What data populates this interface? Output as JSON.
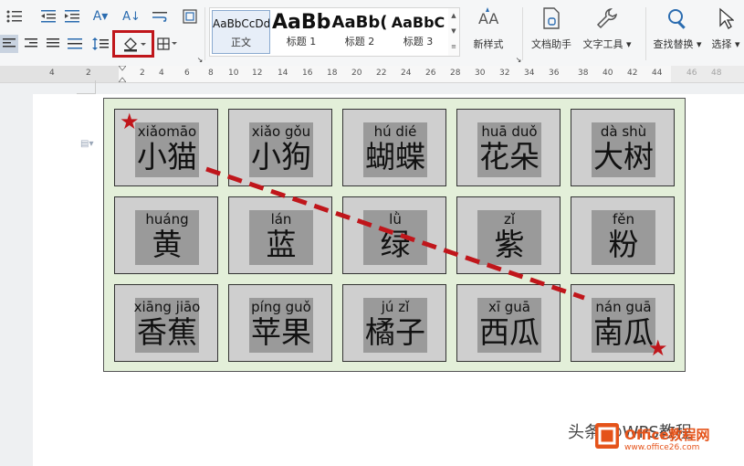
{
  "ribbon": {
    "styles": [
      {
        "preview": "AaBbCcDd",
        "label": "正文"
      },
      {
        "preview": "AaBb",
        "label": "标题 1"
      },
      {
        "preview": "AaBb(",
        "label": "标题 2"
      },
      {
        "preview": "AaBbC",
        "label": "标题 3"
      }
    ],
    "new_style_label": "新样式",
    "doc_assistant_label": "文档助手",
    "text_tools_label": "文字工具",
    "find_replace_label": "查找替换",
    "select_label": "选择"
  },
  "ruler": {
    "ticks": [
      "4",
      "2",
      "2",
      "4",
      "6",
      "8",
      "10",
      "12",
      "14",
      "16",
      "18",
      "20",
      "22",
      "24",
      "26",
      "28",
      "30",
      "32",
      "34",
      "36",
      "38",
      "40",
      "42",
      "44",
      "46",
      "48"
    ]
  },
  "cards": [
    {
      "pinyin": "xiǎomāo",
      "hanzi": "小猫"
    },
    {
      "pinyin": "xiǎo gǒu",
      "hanzi": "小狗"
    },
    {
      "pinyin": "hú  dié",
      "hanzi": "蝴蝶"
    },
    {
      "pinyin": "huā duǒ",
      "hanzi": "花朵"
    },
    {
      "pinyin": "dà  shù",
      "hanzi": "大树"
    },
    {
      "pinyin": "huáng",
      "hanzi": "黄"
    },
    {
      "pinyin": "lán",
      "hanzi": "蓝"
    },
    {
      "pinyin": "lǜ",
      "hanzi": "绿"
    },
    {
      "pinyin": "zǐ",
      "hanzi": "紫"
    },
    {
      "pinyin": "fěn",
      "hanzi": "粉"
    },
    {
      "pinyin": "xiāng jiāo",
      "hanzi": "香蕉"
    },
    {
      "pinyin": "píng guǒ",
      "hanzi": "苹果"
    },
    {
      "pinyin": "jú   zǐ",
      "hanzi": "橘子"
    },
    {
      "pinyin": "xī  guā",
      "hanzi": "西瓜"
    },
    {
      "pinyin": "nán guā",
      "hanzi": "南瓜"
    }
  ],
  "watermark": {
    "text": "头条 @WPS教程",
    "logo_title": "Office教程网",
    "logo_url": "www.office26.com"
  },
  "colors": {
    "table_bg": "#e3efd9",
    "card_bg": "#cfcfcf",
    "highlight_red": "#c0161b",
    "dash_red": "#c0161b"
  }
}
